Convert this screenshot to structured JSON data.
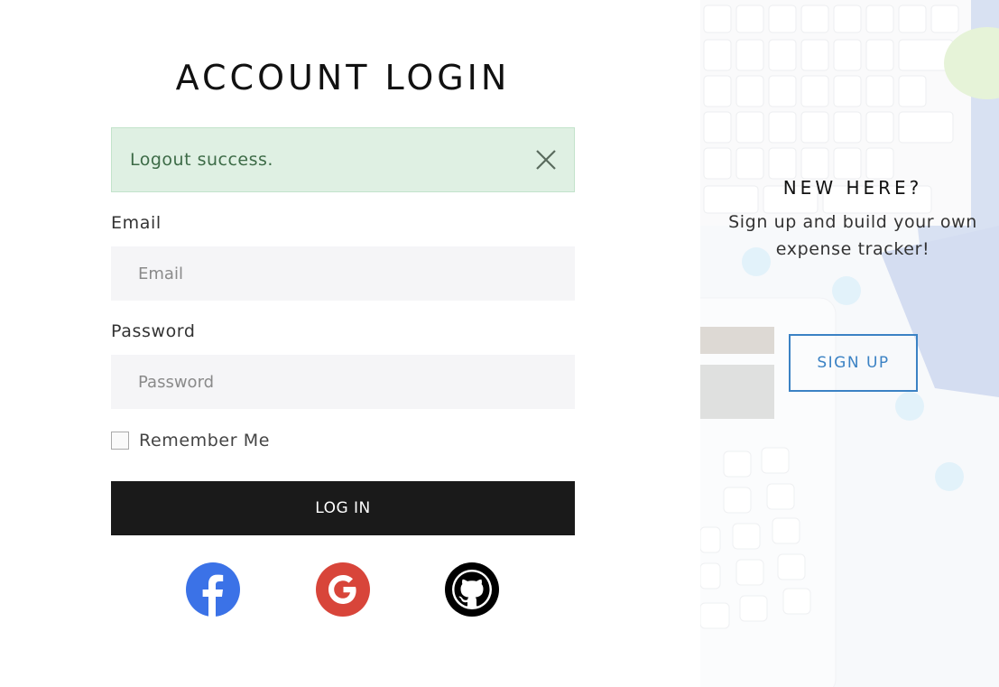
{
  "login": {
    "title": "ACCOUNT LOGIN",
    "alert": {
      "message": "Logout success.",
      "close_icon": "close-icon"
    },
    "email": {
      "label": "Email",
      "placeholder": "Email",
      "value": ""
    },
    "password": {
      "label": "Password",
      "placeholder": "Password",
      "value": ""
    },
    "remember": {
      "label": "Remember Me",
      "checked": false
    },
    "submit_label": "LOG IN",
    "social": [
      {
        "name": "facebook-icon",
        "color": "#3b72e7"
      },
      {
        "name": "google-icon",
        "color": "#d8453a"
      },
      {
        "name": "github-icon",
        "color": "#000000"
      }
    ]
  },
  "signup_panel": {
    "heading": "NEW HERE?",
    "text": "Sign up and build your own expense tracker!",
    "button_label": "SIGN UP",
    "accent": "#3b82c4"
  },
  "colors": {
    "alert_bg": "#dff0e3",
    "alert_text": "#3d6b47",
    "button_bg": "#1a1a1a",
    "input_bg": "#f5f5f7"
  }
}
